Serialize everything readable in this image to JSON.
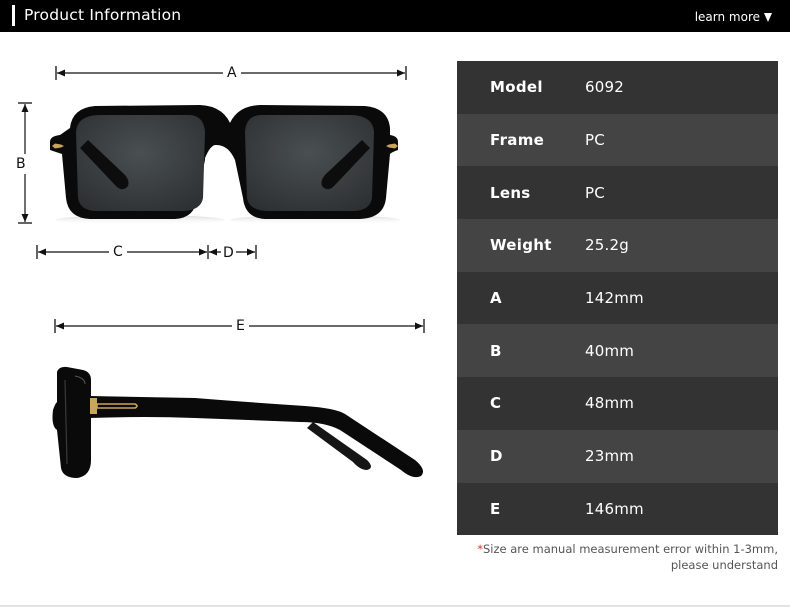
{
  "header": {
    "title": "Product Information",
    "learn_more_label": "learn more",
    "learn_more_icon": "triangle-down-icon"
  },
  "diagram": {
    "front_view": {
      "dimension_labels": [
        "A",
        "B",
        "C",
        "D"
      ],
      "description": "Front view of black square sunglasses with dark gray lenses and gold rivet accents"
    },
    "side_view": {
      "dimension_labels": [
        "E"
      ],
      "description": "Side view of black sunglasses temple with gold hinge accent"
    }
  },
  "specs": {
    "rows": [
      {
        "label": "Model",
        "value": "6092"
      },
      {
        "label": "Frame",
        "value": "PC"
      },
      {
        "label": "Lens",
        "value": "PC"
      },
      {
        "label": "Weight",
        "value": "25.2g"
      },
      {
        "label": "A",
        "value": "142mm"
      },
      {
        "label": "B",
        "value": "40mm"
      },
      {
        "label": "C",
        "value": "48mm"
      },
      {
        "label": "D",
        "value": "23mm"
      },
      {
        "label": "E",
        "value": "146mm"
      }
    ]
  },
  "note": {
    "asterisk": "*",
    "line1": "Size are manual measurement error within 1-3mm,",
    "line2": "please understand"
  },
  "colors": {
    "header_bg": "#000000",
    "row_dark": "#333333",
    "row_light": "#444444",
    "note_asterisk": "#e5322d",
    "lens": "#3d4245",
    "frame": "#0a0a0a",
    "accent_gold": "#c9a45a"
  }
}
